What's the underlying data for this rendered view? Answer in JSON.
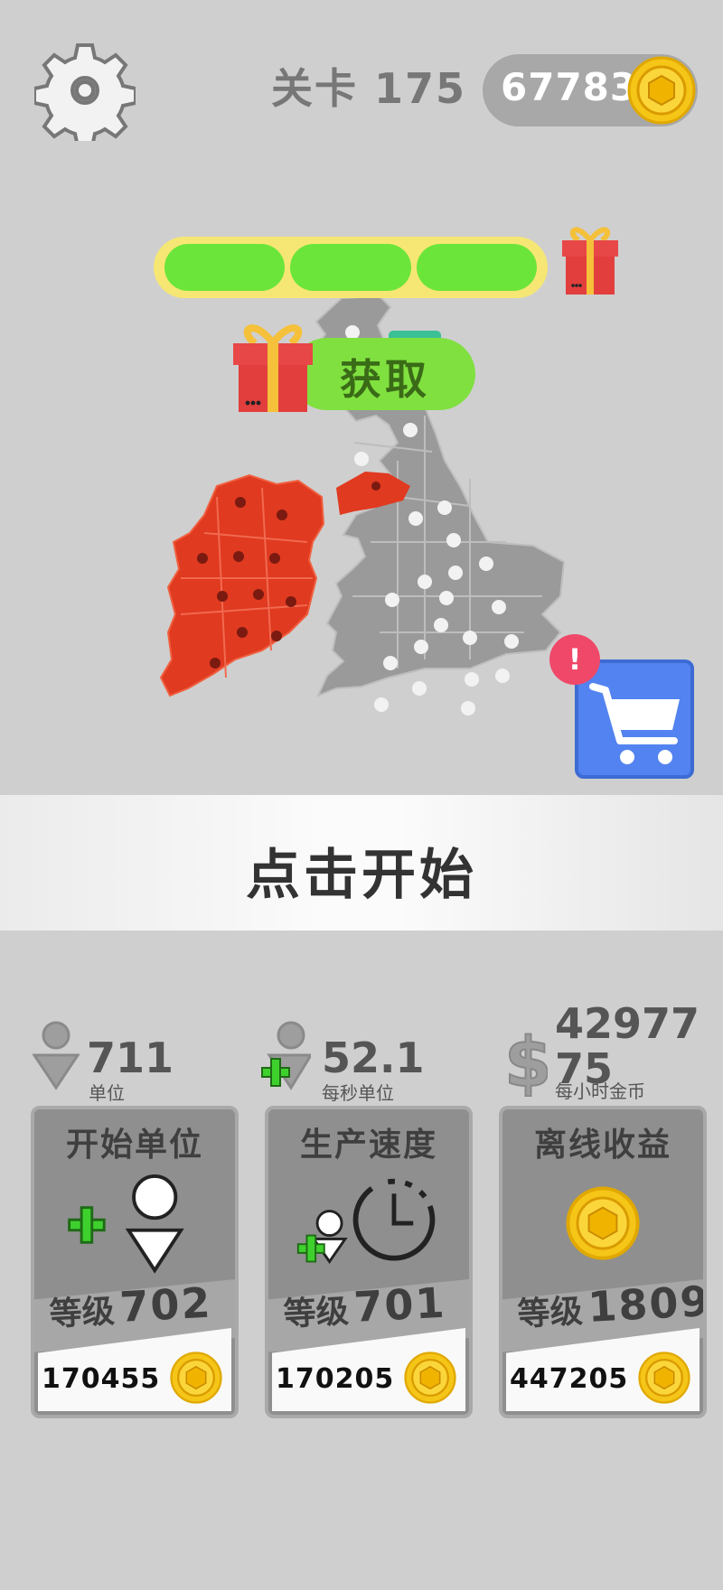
{
  "header": {
    "level_label": "关卡 175",
    "coins": "67783",
    "settings_icon": "gear-icon",
    "coin_icon": "gold-coin-icon"
  },
  "map": {
    "region": "British Isles",
    "conquered_color": "#e03a20",
    "neutral_color": "#9a9a9a",
    "progress_segments_filled": 3,
    "progress_segments_total": 3,
    "get_button_label": "获取",
    "gift_icon": "gift-box-icon",
    "shop_icon": "shopping-cart-icon",
    "alert_label": "!"
  },
  "start": {
    "label": "点击开始"
  },
  "stats": {
    "units": {
      "value": "711",
      "label": "单位",
      "icon": "person-icon"
    },
    "rate": {
      "value": "52.1",
      "label": "每秒单位",
      "icon": "add-person-icon"
    },
    "offline": {
      "value_line1": "42977",
      "value_line2": "75",
      "label": "每小时金币",
      "icon": "dollar-icon"
    }
  },
  "cards": [
    {
      "title": "开始单位",
      "level_label": "等级",
      "level": "702",
      "price": "170455",
      "art_icon": "add-unit-icon"
    },
    {
      "title": "生产速度",
      "level_label": "等级",
      "level": "701",
      "price": "170205",
      "art_icon": "production-clock-icon"
    },
    {
      "title": "离线收益",
      "level_label": "等级",
      "level": "1809",
      "price": "447205",
      "art_icon": "gold-coin-icon"
    }
  ],
  "colors": {
    "background": "#cfcfcf",
    "progress_fill": "#6ce53a",
    "progress_track": "#f6e774",
    "shop_button": "#5383f0",
    "alert": "#f04869",
    "coin_gold": "#f5c518"
  }
}
